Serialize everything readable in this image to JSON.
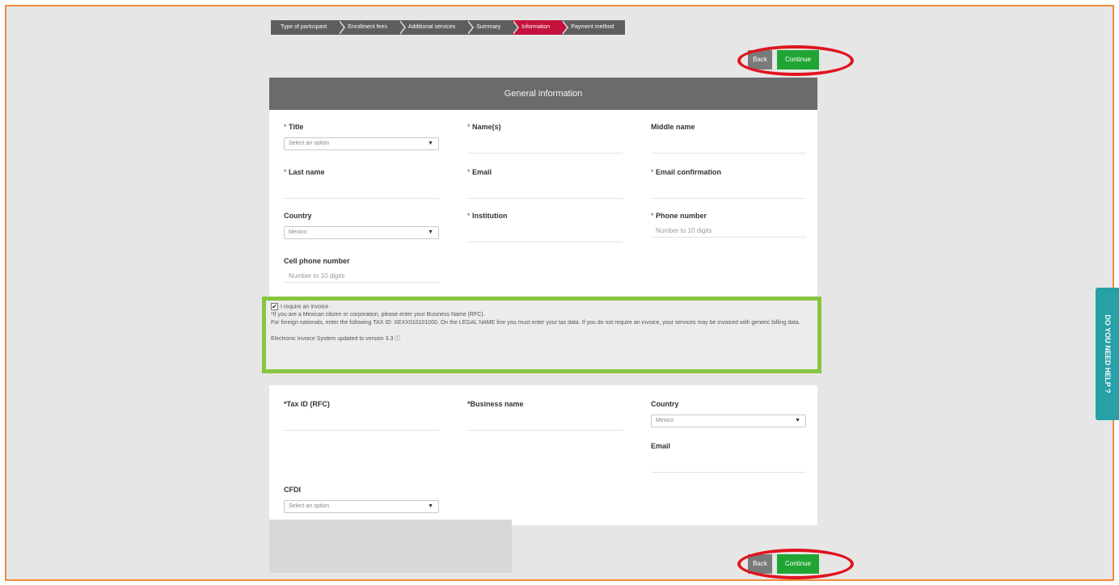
{
  "steps": [
    "Type of participant",
    "Enrollment fees",
    "Additional services",
    "Summary",
    "Information",
    "Payment method"
  ],
  "buttons": {
    "back": "Back",
    "continue": "Continue"
  },
  "card_title": "General information",
  "fields": {
    "title": {
      "req": "*",
      "label": "Title",
      "value": "Select an option"
    },
    "names": {
      "req": "*",
      "label": "Name(s)",
      "value": ""
    },
    "middle": {
      "req": "",
      "label": "Middle name",
      "value": ""
    },
    "last": {
      "req": "*",
      "label": "Last name",
      "value": ""
    },
    "email": {
      "req": "*",
      "label": "Email",
      "value": ""
    },
    "email_conf": {
      "req": "*",
      "label": "Email confirmation",
      "value": ""
    },
    "country": {
      "req": "",
      "label": "Country",
      "value": "Mexico"
    },
    "institution": {
      "req": "*",
      "label": "Institution",
      "value": ""
    },
    "phone": {
      "req": "*",
      "label": "Phone number",
      "placeholder": "Number to 10 digits"
    },
    "cell": {
      "req": "",
      "label": "Cell phone number",
      "placeholder": "Number to 10 digits"
    }
  },
  "invoice": {
    "checkbox_label": "I require an invoice",
    "line1": "*If you are a Mexican citizen or corporation, please enter your Business Name (RFC).",
    "line2": "For foreign nationals, enter the following TAX ID: XEXX010101000. On the LEGAL NAME line you must enter your tax data. If you do not require an invoice, your services may be invoiced with generic billing data.",
    "line3": "Electronic Invoice System updated to version 3.3 ⓘ"
  },
  "billing": {
    "taxid": {
      "label": "*Tax ID (RFC)"
    },
    "business": {
      "label": "*Business name"
    },
    "country": {
      "label": "Country",
      "value": "Mexico"
    },
    "email": {
      "label": "Email"
    },
    "cfdi": {
      "label": "CFDI",
      "value": "Select an option"
    }
  },
  "help": "DO YOU NEED HELP ?",
  "colors": {
    "active_step": "#c4123c",
    "continue": "#20a534",
    "highlight": "#87c63f",
    "annotation": "#e0141e",
    "help": "#27a0a8"
  }
}
